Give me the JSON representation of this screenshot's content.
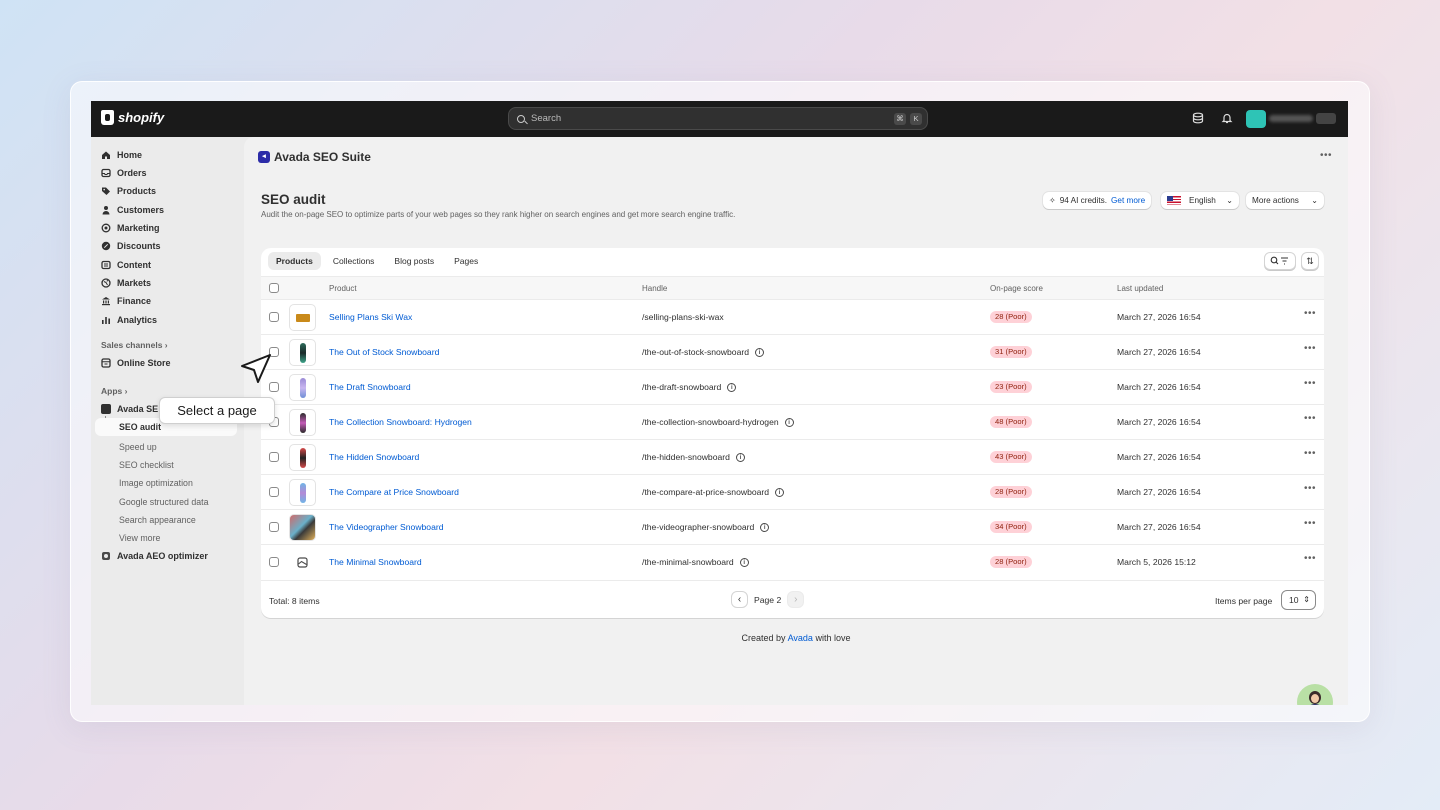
{
  "topbar": {
    "brand": "shopify",
    "search_placeholder": "Search",
    "shortcut_keys": [
      "⌘",
      "K"
    ]
  },
  "sidebar": {
    "nav": [
      {
        "label": "Home",
        "icon": "home-icon"
      },
      {
        "label": "Orders",
        "icon": "orders-icon"
      },
      {
        "label": "Products",
        "icon": "tag-icon"
      },
      {
        "label": "Customers",
        "icon": "person-icon"
      },
      {
        "label": "Marketing",
        "icon": "target-icon"
      },
      {
        "label": "Discounts",
        "icon": "discount-icon"
      },
      {
        "label": "Content",
        "icon": "content-icon"
      },
      {
        "label": "Markets",
        "icon": "globe-icon"
      },
      {
        "label": "Finance",
        "icon": "bank-icon"
      },
      {
        "label": "Analytics",
        "icon": "bar-chart-icon"
      }
    ],
    "sales_channels_label": "Sales channels",
    "online_store": "Online Store",
    "apps_label": "Apps",
    "app_name": "Avada SE",
    "sub_items": [
      "SEO audit",
      "Speed up",
      "SEO checklist",
      "Image optimization",
      "Google structured data",
      "Search appearance",
      "View more"
    ],
    "aeo": "Avada AEO optimizer"
  },
  "header": {
    "app_title": "Avada SEO Suite",
    "page_title": "SEO audit",
    "page_subtitle": "Audit the on-page SEO to optimize parts of your web pages so they rank higher on search engines and get more search engine traffic.",
    "credits_text": "94 AI credits.",
    "credits_link": "Get more",
    "language": "English",
    "more_actions": "More actions"
  },
  "tabs": [
    "Products",
    "Collections",
    "Blog posts",
    "Pages"
  ],
  "table": {
    "columns": [
      "Product",
      "Handle",
      "On-page score",
      "Last updated"
    ],
    "rows": [
      {
        "product": "Selling Plans Ski Wax",
        "handle": "/selling-plans-ski-wax",
        "score": "28 (Poor)",
        "updated": "March 27, 2026 16:54",
        "info": false
      },
      {
        "product": "The Out of Stock Snowboard",
        "handle": "/the-out-of-stock-snowboard",
        "score": "31 (Poor)",
        "updated": "March 27, 2026 16:54",
        "info": true
      },
      {
        "product": "The Draft Snowboard",
        "handle": "/the-draft-snowboard",
        "score": "23 (Poor)",
        "updated": "March 27, 2026 16:54",
        "info": true
      },
      {
        "product": "The Collection Snowboard: Hydrogen",
        "handle": "/the-collection-snowboard-hydrogen",
        "score": "48 (Poor)",
        "updated": "March 27, 2026 16:54",
        "info": true
      },
      {
        "product": "The Hidden Snowboard",
        "handle": "/the-hidden-snowboard",
        "score": "43 (Poor)",
        "updated": "March 27, 2026 16:54",
        "info": true
      },
      {
        "product": "The Compare at Price Snowboard",
        "handle": "/the-compare-at-price-snowboard",
        "score": "28 (Poor)",
        "updated": "March 27, 2026 16:54",
        "info": true
      },
      {
        "product": "The Videographer Snowboard",
        "handle": "/the-videographer-snowboard",
        "score": "34 (Poor)",
        "updated": "March 27, 2026 16:54",
        "info": true
      },
      {
        "product": "The Minimal Snowboard",
        "handle": "/the-minimal-snowboard",
        "score": "28 (Poor)",
        "updated": "March 5, 2026 15:12",
        "info": true
      }
    ]
  },
  "footer": {
    "total": "Total: 8 items",
    "page": "Page 2",
    "items_per_page_label": "Items per page",
    "items_per_page": "10"
  },
  "credit": {
    "prefix": "Created by",
    "link": "Avada",
    "suffix": "with love"
  },
  "tooltip": "Select a page",
  "colors": {
    "link": "#005bd3",
    "badge_bg": "#fed1d7",
    "badge_text": "#8e1f0b",
    "topbar": "#1a1a1a"
  }
}
